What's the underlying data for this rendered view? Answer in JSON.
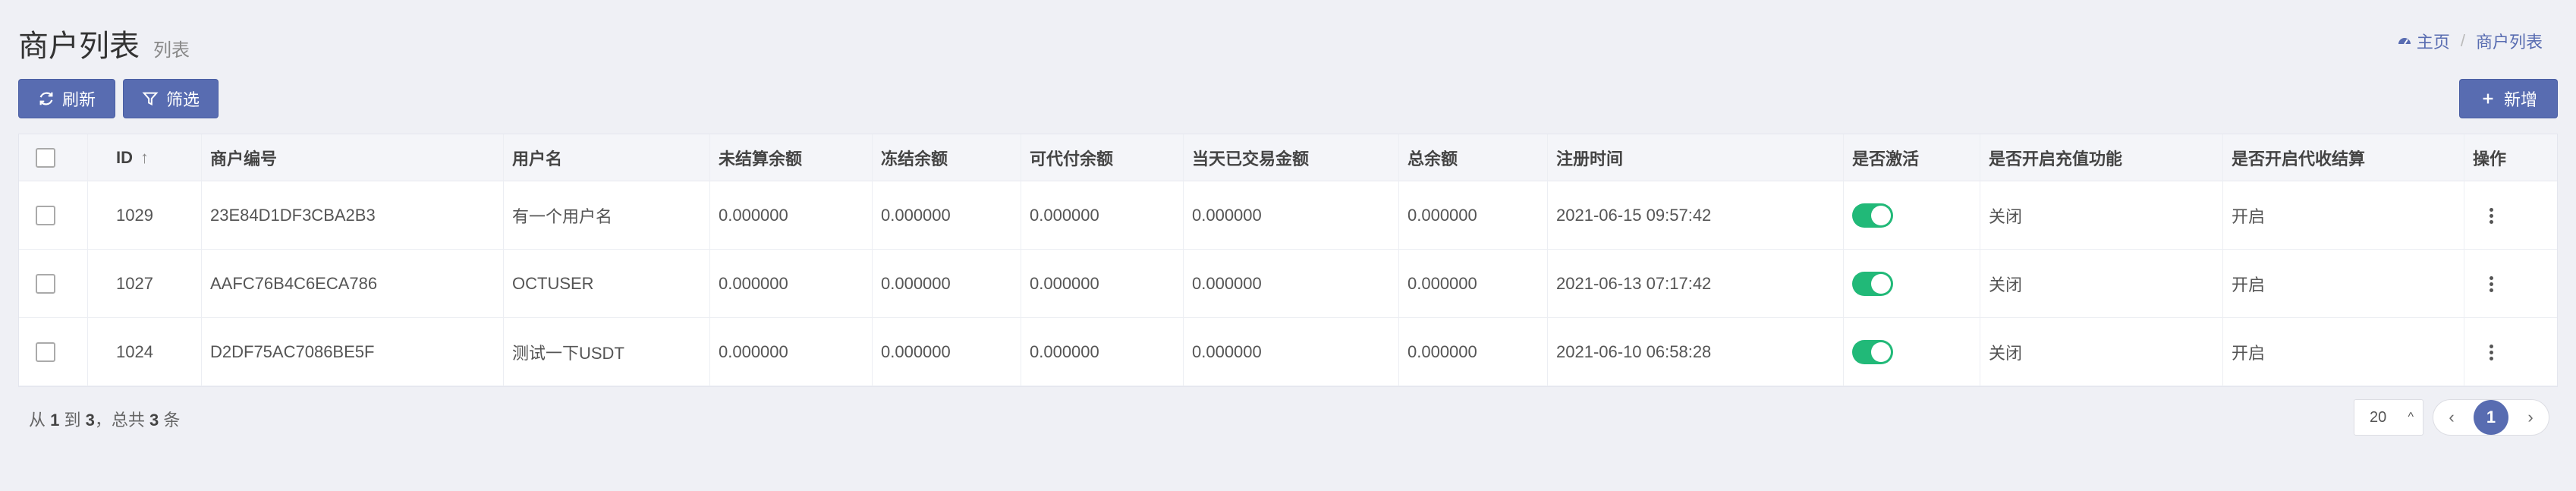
{
  "header": {
    "title": "商户列表",
    "subtitle": "列表"
  },
  "breadcrumb": {
    "home": "主页",
    "separator": "/",
    "current": "商户列表"
  },
  "toolbar": {
    "refresh_label": "刷新",
    "filter_label": "筛选",
    "new_label": "新增"
  },
  "table": {
    "columns": [
      "ID",
      "商户编号",
      "用户名",
      "未结算余额",
      "冻结余额",
      "可代付余额",
      "当天已交易金额",
      "总余额",
      "注册时间",
      "是否激活",
      "是否开启充值功能",
      "是否开启代收结算",
      "操作"
    ],
    "sort_indicator": "↑",
    "rows": [
      {
        "id": "1029",
        "merchant_no": "23E84D1DF3CBA2B3",
        "username": "有一个用户名",
        "unsettled": "0.000000",
        "frozen": "0.000000",
        "payable": "0.000000",
        "today_amount": "0.000000",
        "total": "0.000000",
        "registered": "2021-06-15 09:57:42",
        "active": true,
        "recharge": "关闭",
        "collection": "开启"
      },
      {
        "id": "1027",
        "merchant_no": "AAFC76B4C6ECA786",
        "username": "OCTUSER",
        "unsettled": "0.000000",
        "frozen": "0.000000",
        "payable": "0.000000",
        "today_amount": "0.000000",
        "total": "0.000000",
        "registered": "2021-06-13 07:17:42",
        "active": true,
        "recharge": "关闭",
        "collection": "开启"
      },
      {
        "id": "1024",
        "merchant_no": "D2DF75AC7086BE5F",
        "username": "测试一下USDT",
        "unsettled": "0.000000",
        "frozen": "0.000000",
        "payable": "0.000000",
        "today_amount": "0.000000",
        "total": "0.000000",
        "registered": "2021-06-10 06:58:28",
        "active": true,
        "recharge": "关闭",
        "collection": "开启"
      }
    ]
  },
  "footer": {
    "summary_prefix": "从",
    "from": "1",
    "to_word": "到",
    "to": "3",
    "total_word": "，总共",
    "total": "3",
    "unit": "条"
  },
  "pagination": {
    "page_size": "20",
    "current_page": "1",
    "prev": "‹",
    "next": "›",
    "size_caret": "^"
  },
  "colors": {
    "primary": "#586cb1",
    "switch_on": "#21b978",
    "background": "#eff0f5"
  },
  "icons": {
    "refresh": "refresh-icon",
    "filter": "filter-icon",
    "new": "plus-icon",
    "home": "dashboard-icon",
    "actions": "kebab-icon"
  }
}
